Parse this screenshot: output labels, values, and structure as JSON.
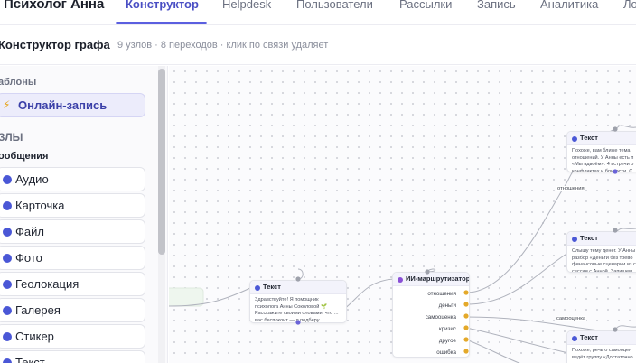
{
  "app": {
    "title": "Психолог Анна"
  },
  "nav": {
    "tabs": [
      {
        "label": "Конструктор",
        "active": true
      },
      {
        "label": "Helpdesk"
      },
      {
        "label": "Пользователи"
      },
      {
        "label": "Рассылки"
      },
      {
        "label": "Запись"
      },
      {
        "label": "Аналитика"
      },
      {
        "label": "Ло"
      }
    ]
  },
  "header": {
    "title": "Конструктор графа",
    "meta": "9 узлов · 8 переходов · клик по связи удаляет"
  },
  "sidebar": {
    "templates_heading": "аблоны",
    "template": {
      "icon": "lightning-icon",
      "label": "Онлайн-запись"
    },
    "nodes_heading": "ЗЛЫ",
    "messages_heading": "ообщения",
    "items": [
      {
        "label": "Аудио"
      },
      {
        "label": "Карточка"
      },
      {
        "label": "Файл"
      },
      {
        "label": "Фото"
      },
      {
        "label": "Геолокация"
      },
      {
        "label": "Галерея"
      },
      {
        "label": "Стикер"
      },
      {
        "label": "Текст"
      }
    ]
  },
  "graph": {
    "nodes": [
      {
        "title": "Текст",
        "body": "Здравствуйте! Я помощник психолога Анны Соколовой 🌱 Расскажите своими словами, что ... вас беспокоит — я подберу"
      },
      {
        "title": "ИИ-маршрутизатор",
        "ports": [
          "отношения",
          "деньги",
          "самооценка",
          "кризис",
          "другое",
          "ошибка"
        ]
      },
      {
        "title": "Текст",
        "body": "Похоже, вам ближе тема отношений. У Анны есть п «Мы вдвоём»: 4 встречи о конфликтах и близости. С"
      },
      {
        "title": "Текст",
        "body": "Слышу тему денег. У Анны разбор «Деньги без трево финансовые сценарии из се сессии с Анной. Запишем"
      },
      {
        "title": "Текст",
        "body": "Похоже, речь о самооцен ведёт группу «Достаточно"
      }
    ],
    "edge_labels": [
      "отношения",
      "самооценка"
    ]
  }
}
